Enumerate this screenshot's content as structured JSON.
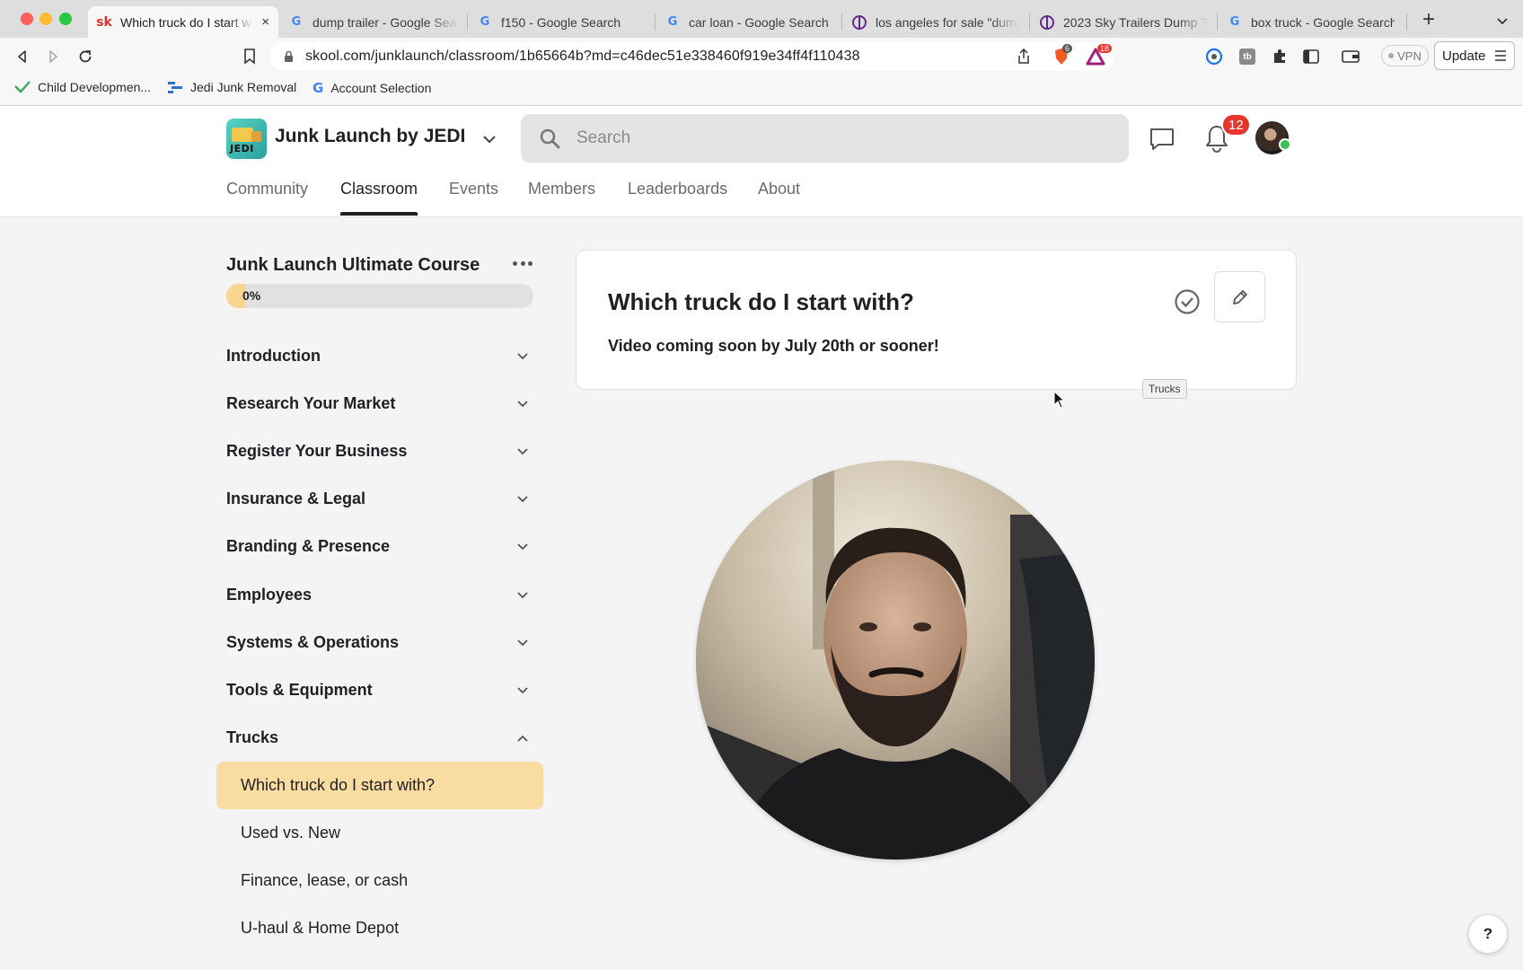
{
  "browser": {
    "tabs": [
      {
        "title": "Which truck do I start w",
        "favicon": "skool-icon",
        "active": true
      },
      {
        "title": "dump trailer - Google Sear",
        "favicon": "google-icon"
      },
      {
        "title": "f150 - Google Search",
        "favicon": "google-icon"
      },
      {
        "title": "car loan - Google Search",
        "favicon": "google-icon"
      },
      {
        "title": "los angeles for sale \"dump",
        "favicon": "craigslist-peace-icon"
      },
      {
        "title": "2023 Sky Trailers Dump Tr",
        "favicon": "craigslist-peace-icon"
      },
      {
        "title": "box truck - Google Search",
        "favicon": "google-icon"
      }
    ],
    "tab_close": "×",
    "new_tab": "+",
    "url": "skool.com/junklaunch/classroom/1b65664b?md=c46dec51e338460f919e34ff4f110438",
    "brave_shield_count": "6",
    "brave_rewards_count": "18",
    "vpn_label": "VPN",
    "update_label": "Update",
    "bookmarks": [
      {
        "label": "Child Developmen...",
        "icon": "checkmark-green-icon"
      },
      {
        "label": "Jedi Junk Removal",
        "icon": "bars-blue-icon"
      },
      {
        "label": "Account Selection",
        "icon": "google-icon"
      }
    ]
  },
  "header": {
    "brand_name": "Junk Launch by JEDI",
    "logo_text": "JEDI",
    "search_placeholder": "Search",
    "notification_count": "12",
    "nav": [
      {
        "label": "Community"
      },
      {
        "label": "Classroom",
        "active": true
      },
      {
        "label": "Events"
      },
      {
        "label": "Members"
      },
      {
        "label": "Leaderboards"
      },
      {
        "label": "About"
      }
    ]
  },
  "sidebar": {
    "course_title": "Junk Launch Ultimate Course",
    "progress_label": "0%",
    "progress_fraction": 0.06,
    "sections": [
      {
        "label": "Introduction",
        "expanded": false
      },
      {
        "label": "Research Your Market",
        "expanded": false
      },
      {
        "label": "Register Your Business",
        "expanded": false
      },
      {
        "label": "Insurance & Legal",
        "expanded": false
      },
      {
        "label": "Branding & Presence",
        "expanded": false
      },
      {
        "label": "Employees",
        "expanded": false
      },
      {
        "label": "Systems & Operations",
        "expanded": false
      },
      {
        "label": "Tools & Equipment",
        "expanded": false
      },
      {
        "label": "Trucks",
        "expanded": true
      }
    ],
    "lessons": [
      {
        "label": "Which truck do I start with?",
        "active": true
      },
      {
        "label": "Used vs. New"
      },
      {
        "label": "Finance, lease, or cash"
      },
      {
        "label": "U-haul & Home Depot"
      }
    ]
  },
  "lesson": {
    "title": "Which truck do I start with?",
    "subtitle": "Video coming soon by July 20th or sooner!",
    "tooltip": "Trucks"
  },
  "help_label": "?",
  "colors": {
    "accent_active_lesson": "#f8dca1",
    "badge_red": "#e5352d",
    "page_bg": "#f4f4f4"
  }
}
